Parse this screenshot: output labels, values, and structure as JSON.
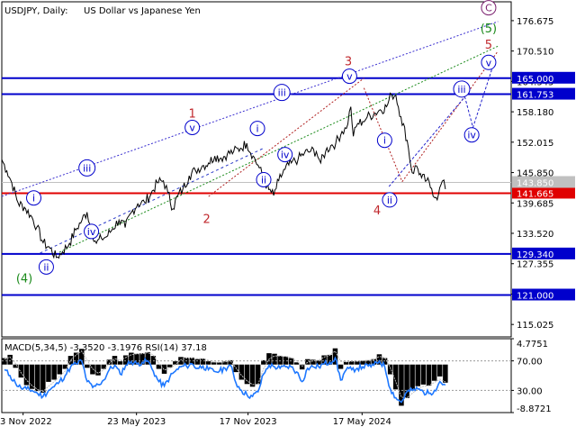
{
  "header": {
    "symbol": "USDJPY, Daily:",
    "description": "US Dollar vs Japanese Yen"
  },
  "chart_data": {
    "type": "line",
    "price_axis": {
      "ticks": [
        176.675,
        170.51,
        164.345,
        158.18,
        152.015,
        145.85,
        139.685,
        133.52,
        127.355,
        121.19,
        115.025
      ],
      "ylim": [
        112.5,
        180.5
      ]
    },
    "time_axis": {
      "labels": [
        "23 Nov 2022",
        "23 May 2023",
        "17 Nov 2023",
        "17 May 2024"
      ],
      "xlim": [
        "2022-10-20",
        "2025-01-10"
      ]
    },
    "series": [
      {
        "x": [
          "2022-10-20",
          "2022-10-28",
          "2022-11-05",
          "2022-11-15",
          "2022-11-25",
          "2022-12-05",
          "2022-12-15",
          "2022-12-25",
          "2023-01-05",
          "2023-01-15",
          "2023-01-25",
          "2023-02-05",
          "2023-02-15",
          "2023-02-25",
          "2023-03-05",
          "2023-03-12",
          "2023-03-20",
          "2023-03-28",
          "2023-04-05",
          "2023-04-15",
          "2023-04-25",
          "2023-05-05",
          "2023-05-15",
          "2023-05-25",
          "2023-06-05",
          "2023-06-15",
          "2023-06-25",
          "2023-07-05",
          "2023-07-12",
          "2023-07-20",
          "2023-07-28",
          "2023-08-05",
          "2023-08-15",
          "2023-08-25",
          "2023-09-05",
          "2023-09-15",
          "2023-09-25",
          "2023-10-05",
          "2023-10-15",
          "2023-10-25",
          "2023-11-05",
          "2023-11-15",
          "2023-11-25",
          "2023-12-05",
          "2023-12-12",
          "2023-12-20",
          "2023-12-28",
          "2024-01-05",
          "2024-01-15",
          "2024-01-25",
          "2024-02-05",
          "2024-02-15",
          "2024-02-25",
          "2024-03-05",
          "2024-03-12",
          "2024-03-20",
          "2024-03-28",
          "2024-04-05",
          "2024-04-15",
          "2024-04-22",
          "2024-04-29",
          "2024-05-03",
          "2024-05-10",
          "2024-05-18",
          "2024-05-25",
          "2024-06-05",
          "2024-06-15",
          "2024-06-25",
          "2024-07-03",
          "2024-07-10",
          "2024-07-18",
          "2024-07-28",
          "2024-08-05",
          "2024-08-12",
          "2024-08-20",
          "2024-08-28",
          "2024-09-05",
          "2024-09-12",
          "2024-09-16",
          "2024-09-22",
          "2024-09-27"
        ],
        "y": [
          148.5,
          146.2,
          143.8,
          139.7,
          138.8,
          137.2,
          134.8,
          131.6,
          130.5,
          128.6,
          129.8,
          131.5,
          134.2,
          136.2,
          137.8,
          134.2,
          131.5,
          132.5,
          132.8,
          134.5,
          136.2,
          134.7,
          137.8,
          139.5,
          139.8,
          141.5,
          143.8,
          144.2,
          141.8,
          138.5,
          141.2,
          142.5,
          145.2,
          146.3,
          147.2,
          147.8,
          149.2,
          148.8,
          149.6,
          150.1,
          150.8,
          151.8,
          149.2,
          146.8,
          144.5,
          142.4,
          141.2,
          144.2,
          146.5,
          147.8,
          148.6,
          149.8,
          150.2,
          150.1,
          147.8,
          150.2,
          151.3,
          151.8,
          154.2,
          154.8,
          159.2,
          153.2,
          155.8,
          156.2,
          157.1,
          157.8,
          158.6,
          159.2,
          161.7,
          161.5,
          157.2,
          152.4,
          145.8,
          147.2,
          144.8,
          144.2,
          142.6,
          140.8,
          141.4,
          144.1,
          142.5
        ]
      }
    ],
    "price_box": "143.850",
    "levels": [
      {
        "value": 165.0,
        "label": "165.000",
        "color": "#0000cc"
      },
      {
        "value": 161.753,
        "label": "161.753",
        "color": "#0000cc"
      },
      {
        "value": 141.665,
        "label": "141.665",
        "color": "#e00000"
      },
      {
        "value": 129.34,
        "label": "129.340",
        "color": "#0000cc"
      },
      {
        "value": 121.0,
        "label": "121.000",
        "color": "#0000cc"
      }
    ],
    "wave_labels": [
      {
        "text": "C",
        "date": "2024-12-05",
        "price": 179.3,
        "style": "circle",
        "color": "#7a1f6e"
      },
      {
        "text": "(5)",
        "date": "2024-12-05",
        "price": 175.2,
        "style": "plain",
        "color": "#1a8a1a"
      },
      {
        "text": "5",
        "date": "2024-12-05",
        "price": 171.9,
        "style": "plain",
        "color": "#c0282d"
      },
      {
        "text": "v",
        "date": "2024-12-05",
        "price": 168.2,
        "style": "circle",
        "color": "#0000cc"
      },
      {
        "text": "iii",
        "date": "2024-10-23",
        "price": 162.8,
        "style": "circle",
        "color": "#0000cc"
      },
      {
        "text": "iv",
        "date": "2024-11-08",
        "price": 153.5,
        "style": "circle",
        "color": "#0000cc"
      },
      {
        "text": "3",
        "date": "2024-04-25",
        "price": 168.5,
        "style": "plain",
        "color": "#c0282d"
      },
      {
        "text": "v",
        "date": "2024-04-27",
        "price": 165.4,
        "style": "circle",
        "color": "#0000cc"
      },
      {
        "text": "iii",
        "date": "2024-01-10",
        "price": 162.1,
        "style": "circle",
        "color": "#0000cc"
      },
      {
        "text": "i",
        "date": "2023-12-02",
        "price": 154.8,
        "style": "circle",
        "color": "#0000cc"
      },
      {
        "text": "iv",
        "date": "2024-01-15",
        "price": 149.5,
        "style": "circle",
        "color": "#0000cc"
      },
      {
        "text": "ii",
        "date": "2023-12-12",
        "price": 144.4,
        "style": "circle",
        "color": "#0000cc"
      },
      {
        "text": "1",
        "date": "2023-08-20",
        "price": 157.9,
        "style": "plain",
        "color": "#c0282d"
      },
      {
        "text": "v",
        "date": "2023-08-20",
        "price": 155.0,
        "style": "circle",
        "color": "#0000cc"
      },
      {
        "text": "2",
        "date": "2023-09-12",
        "price": 136.5,
        "style": "plain",
        "color": "#c0282d"
      },
      {
        "text": "iii",
        "date": "2023-03-05",
        "price": 146.8,
        "style": "circle",
        "color": "#0000cc"
      },
      {
        "text": "iv",
        "date": "2023-03-12",
        "price": 133.9,
        "style": "circle",
        "color": "#0000cc"
      },
      {
        "text": "i",
        "date": "2022-12-10",
        "price": 140.7,
        "style": "circle",
        "color": "#0000cc"
      },
      {
        "text": "ii",
        "date": "2022-12-30",
        "price": 126.7,
        "style": "circle",
        "color": "#0000cc"
      },
      {
        "text": "(4)",
        "date": "2022-11-25",
        "price": 124.5,
        "style": "plain",
        "color": "#1a8a1a"
      },
      {
        "text": "i",
        "date": "2024-06-22",
        "price": 152.4,
        "style": "circle",
        "color": "#0000cc"
      },
      {
        "text": "4",
        "date": "2024-06-10",
        "price": 138.3,
        "style": "plain",
        "color": "#c0282d"
      },
      {
        "text": "ii",
        "date": "2024-06-30",
        "price": 140.3,
        "style": "circle",
        "color": "#0000cc"
      }
    ],
    "trendlines": [
      {
        "from": [
          "2022-10-20",
          141.0
        ],
        "to": [
          "2024-12-20",
          176.5
        ],
        "color": "#3a2fd0",
        "dash": "2,2"
      },
      {
        "from": [
          "2023-01-20",
          129.7
        ],
        "to": [
          "2024-12-20",
          171.5
        ],
        "color": "#1a8a1a",
        "dash": "2,2"
      },
      {
        "from": [
          "2022-12-20",
          129.5
        ],
        "to": [
          "2023-12-12",
          150.8
        ],
        "color": "#2a3ac8",
        "dash": "3,3"
      },
      {
        "from": [
          "2023-09-15",
          141.0
        ],
        "to": [
          "2024-05-20",
          165.0
        ],
        "color": "#b02020",
        "dash": "2,2"
      },
      {
        "from": [
          "2024-05-20",
          163.0
        ],
        "to": [
          "2024-07-20",
          144.0
        ],
        "color": "#b02020",
        "dash": "2,2"
      },
      {
        "from": [
          "2024-07-20",
          144.0
        ],
        "to": [
          "2024-12-20",
          170.5
        ],
        "color": "#b02020",
        "dash": "2,2"
      }
    ],
    "forecast_path": {
      "points": [
        [
          "2024-06-29",
          143.0
        ],
        [
          "2024-10-28",
          161.2
        ],
        [
          "2024-11-10",
          155.0
        ],
        [
          "2024-12-12",
          167.5
        ]
      ],
      "color": "#2222cc"
    },
    "indicator": {
      "title": "MACD(5,34,5) -3.3520 -3.1976 RSI(14) 37.18",
      "ticks": [
        {
          "label": "4.7751"
        },
        {
          "label": "70.00"
        },
        {
          "label": "30.00"
        },
        {
          "label": "-8.8721"
        }
      ],
      "rsi_levels": [
        70,
        30
      ],
      "macd_range": [
        -8.8721,
        4.7751
      ],
      "rsi_range": [
        0,
        100
      ],
      "macd_hist": [
        1.2,
        1.8,
        -0.6,
        -2.4,
        -3.8,
        -4.5,
        -4.9,
        -5.2,
        -3.2,
        -2.8,
        -1.8,
        -0.8,
        1.6,
        2.2,
        2.9,
        -0.6,
        -1.8,
        -2.0,
        -0.8,
        0.9,
        1.6,
        0.6,
        1.7,
        2.2,
        2.0,
        2.1,
        2.3,
        1.6,
        -0.8,
        -1.7,
        -0.5,
        0.6,
        1.4,
        1.3,
        1.3,
        1.0,
        1.1,
        0.6,
        0.4,
        0.4,
        0.6,
        0.8,
        -1.4,
        -2.8,
        -3.6,
        -4.1,
        -3.6,
        0.8,
        2.1,
        2.0,
        1.6,
        1.5,
        1.2,
        0.4,
        -0.9,
        1.0,
        0.9,
        0.8,
        1.7,
        1.8,
        3.0,
        -0.8,
        0.5,
        0.6,
        0.6,
        0.7,
        0.8,
        1.0,
        1.9,
        1.2,
        -1.8,
        -4.6,
        -7.6,
        -6.2,
        -4.8,
        -4.0,
        -3.7,
        -3.9,
        -3.0,
        -2.2,
        -3.35
      ],
      "macd_signal": [
        1.0,
        1.4,
        0.2,
        -1.5,
        -2.9,
        -3.9,
        -4.6,
        -5.0,
        -4.0,
        -3.2,
        -2.2,
        -1.2,
        0.8,
        1.8,
        2.5,
        0.8,
        -0.8,
        -1.6,
        -1.0,
        0.2,
        1.1,
        0.8,
        1.3,
        1.8,
        2.0,
        2.0,
        2.2,
        1.8,
        0.2,
        -1.0,
        -0.7,
        0.0,
        0.9,
        1.2,
        1.2,
        1.1,
        1.1,
        0.8,
        0.5,
        0.4,
        0.5,
        0.7,
        -0.6,
        -2.0,
        -3.0,
        -3.7,
        -3.7,
        -0.8,
        1.0,
        1.6,
        1.6,
        1.5,
        1.3,
        0.7,
        -0.3,
        0.4,
        0.7,
        0.8,
        1.4,
        1.7,
        2.5,
        0.6,
        0.5,
        0.6,
        0.6,
        0.7,
        0.8,
        0.9,
        1.5,
        1.3,
        -0.6,
        -3.2,
        -6.0,
        -6.2,
        -5.3,
        -4.5,
        -4.0,
        -3.9,
        -3.3,
        -2.7,
        -3.2
      ],
      "rsi": [
        58,
        50,
        40,
        33,
        32,
        30,
        26,
        22,
        30,
        35,
        42,
        50,
        62,
        66,
        70,
        42,
        34,
        38,
        44,
        58,
        64,
        52,
        64,
        69,
        66,
        68,
        70,
        56,
        42,
        36,
        48,
        56,
        62,
        63,
        66,
        60,
        63,
        58,
        56,
        56,
        60,
        64,
        40,
        30,
        24,
        22,
        28,
        52,
        64,
        62,
        60,
        62,
        62,
        55,
        42,
        60,
        62,
        62,
        66,
        68,
        74,
        44,
        58,
        58,
        60,
        62,
        63,
        64,
        70,
        62,
        32,
        20,
        14,
        28,
        30,
        32,
        28,
        26,
        30,
        42,
        37.18
      ]
    }
  }
}
